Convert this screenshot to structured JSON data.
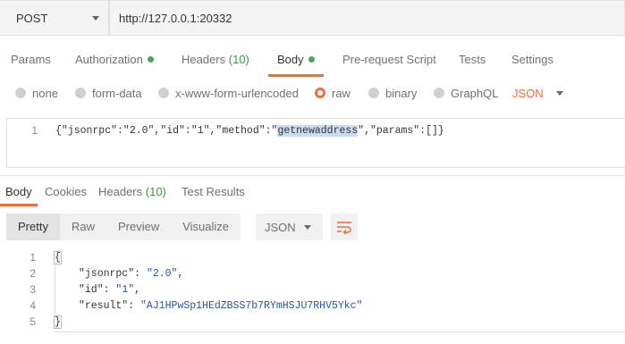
{
  "request": {
    "method": "POST",
    "url": "http://127.0.0.1:20332"
  },
  "request_tabs": {
    "params": "Params",
    "authorization": "Authorization",
    "headers": "Headers",
    "headers_count": "(10)",
    "body": "Body",
    "prerequest": "Pre-request Script",
    "tests": "Tests",
    "settings": "Settings"
  },
  "body_types": {
    "none": "none",
    "form_data": "form-data",
    "urlencoded": "x-www-form-urlencoded",
    "raw": "raw",
    "binary": "binary",
    "graphql": "GraphQL",
    "format": "JSON"
  },
  "request_body": {
    "line_no": "1",
    "code_before": "{\"jsonrpc\":\"2.0\",\"id\":\"1\",\"method\":\"",
    "code_highlight": "getnewaddress",
    "code_after": "\",\"params\":[]}"
  },
  "response_tabs": {
    "body": "Body",
    "cookies": "Cookies",
    "headers": "Headers",
    "headers_count": "(10)",
    "test_results": "Test Results"
  },
  "response_toolbar": {
    "pretty": "Pretty",
    "raw": "Raw",
    "preview": "Preview",
    "visualize": "Visualize",
    "format": "JSON"
  },
  "response_body": {
    "lines": [
      {
        "no": "1",
        "text": "{"
      },
      {
        "no": "2",
        "key": "\"jsonrpc\"",
        "value": "\"2.0\"",
        "suffix": ","
      },
      {
        "no": "3",
        "key": "\"id\"",
        "value": "\"1\"",
        "suffix": ","
      },
      {
        "no": "4",
        "key": "\"result\"",
        "value": "\"AJ1HPwSp1HEdZBSS7b7RYmHSJU7RHV5Ykc\"",
        "suffix": ""
      },
      {
        "no": "5",
        "text": "}"
      }
    ]
  }
}
